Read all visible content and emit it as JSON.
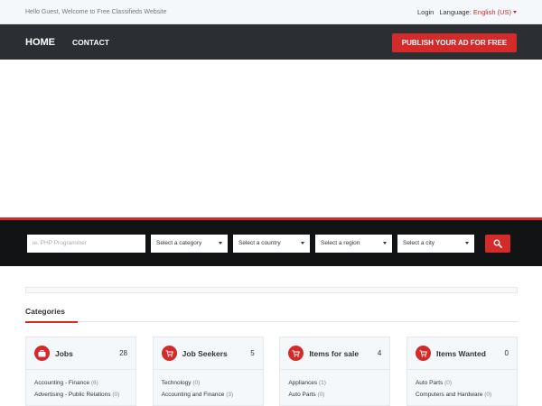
{
  "topbar": {
    "welcome": "Hello Guest, Welcome to Free Classifieds Website",
    "login": "Login",
    "language_label": "Language:",
    "language_value": "English (US)"
  },
  "nav": {
    "home": "HOME",
    "contact": "CONTACT",
    "publish": "PUBLISH YOUR AD FOR FREE"
  },
  "search": {
    "placeholder": "ie. PHP Programmer",
    "category": "Select a category",
    "country": "Select a country",
    "region": "Select a region",
    "city": "Select a city"
  },
  "categories": {
    "title": "Categories",
    "cards": [
      {
        "name": "Jobs",
        "count": "28",
        "icon": "briefcase-icon",
        "items": [
          {
            "label": "Accounting - Finance",
            "count": "(6)"
          },
          {
            "label": "Advertising - Public Relations",
            "count": "(0)"
          }
        ]
      },
      {
        "name": "Job Seekers",
        "count": "5",
        "icon": "cart-icon",
        "items": [
          {
            "label": "Technology",
            "count": "(0)"
          },
          {
            "label": "Accounting and Finance",
            "count": "(3)"
          }
        ]
      },
      {
        "name": "Items for sale",
        "count": "4",
        "icon": "cart-icon",
        "items": [
          {
            "label": "Appliances",
            "count": "(1)"
          },
          {
            "label": "Auto Parts",
            "count": "(0)"
          }
        ]
      },
      {
        "name": "Items Wanted",
        "count": "0",
        "icon": "cart-icon",
        "items": [
          {
            "label": "Auto Parts",
            "count": "(0)"
          },
          {
            "label": "Computers and Hardware",
            "count": "(0)"
          }
        ]
      }
    ]
  },
  "colors": {
    "accent": "#d32a2a",
    "nav_bg": "#2b2f33",
    "search_bg": "#111314"
  }
}
